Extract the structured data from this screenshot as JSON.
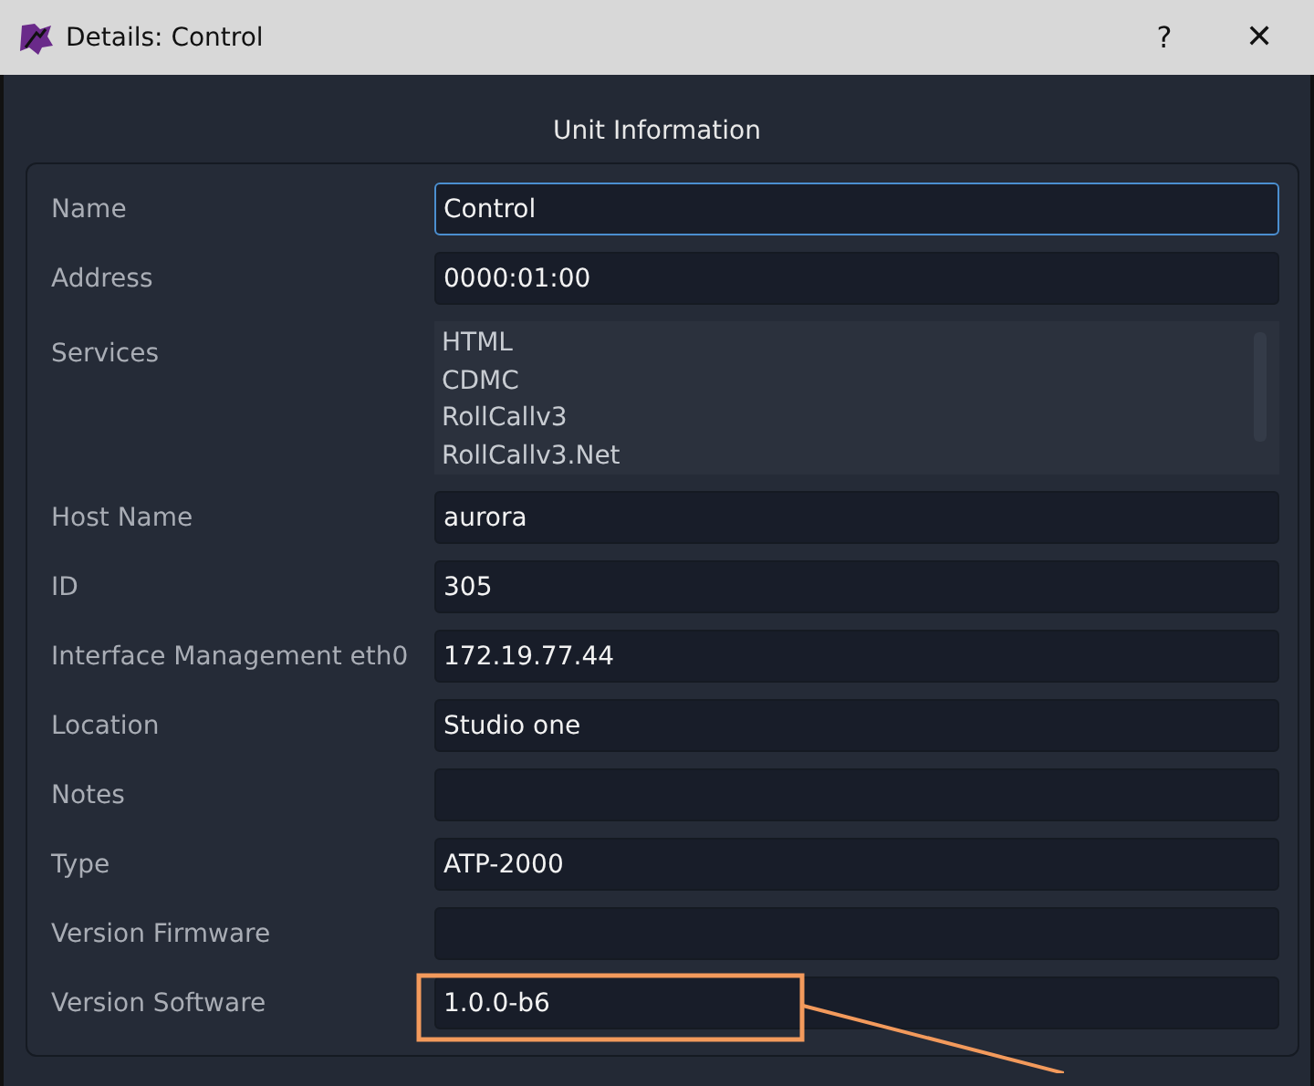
{
  "window": {
    "title": "Details: Control",
    "help": "?",
    "close": "✕"
  },
  "section_title": "Unit Information",
  "rows": [
    {
      "kind": "field",
      "label": "Name",
      "value": "Control",
      "focused": true,
      "highlighted": false
    },
    {
      "kind": "field",
      "label": "Address",
      "value": "0000:01:00",
      "focused": false,
      "highlighted": false
    },
    {
      "kind": "list",
      "label": "Services",
      "items": [
        "HTML",
        "CDMC",
        "RollCallv3",
        "RollCallv3.Net"
      ]
    },
    {
      "kind": "field",
      "label": "Host Name",
      "value": "aurora",
      "focused": false,
      "highlighted": false
    },
    {
      "kind": "field",
      "label": "ID",
      "value": "305",
      "focused": false,
      "highlighted": false
    },
    {
      "kind": "field",
      "label": "Interface Management eth0",
      "value": "172.19.77.44",
      "focused": false,
      "highlighted": false
    },
    {
      "kind": "field",
      "label": "Location",
      "value": "Studio one",
      "focused": false,
      "highlighted": false
    },
    {
      "kind": "field",
      "label": "Notes",
      "value": "",
      "focused": false,
      "highlighted": false
    },
    {
      "kind": "field",
      "label": "Type",
      "value": "ATP-2000",
      "focused": false,
      "highlighted": false
    },
    {
      "kind": "field",
      "label": "Version Firmware",
      "value": "",
      "focused": false,
      "highlighted": false
    },
    {
      "kind": "field",
      "label": "Version Software",
      "value": "1.0.0-b6",
      "focused": false,
      "highlighted": true
    }
  ]
}
